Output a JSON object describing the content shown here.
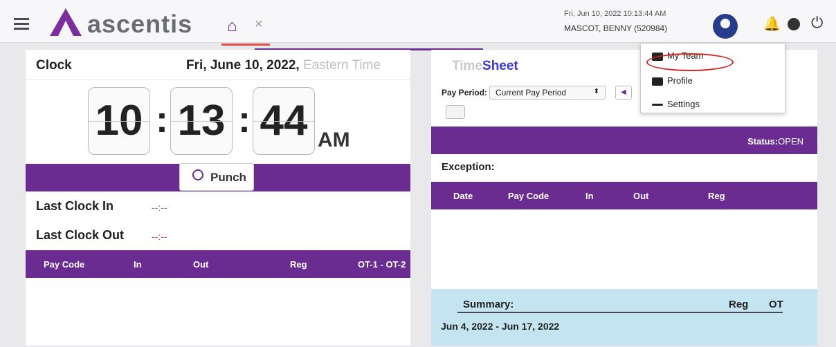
{
  "app": {
    "name": "ascentis"
  },
  "topbar": {
    "date_time": "Fri, Jun 10, 2022 10:13:44 AM",
    "user": "MASCOT, BENNY (520984)"
  },
  "clock": {
    "title": "Clock",
    "date": "Fri, June 10, 2022,",
    "timezone": "Eastern Time",
    "hours": "10",
    "minutes": "13",
    "seconds": "44",
    "ampm": "AM",
    "punch_label": "Punch",
    "last_in_label": "Last Clock In",
    "last_in_value": "--:--",
    "last_out_label": "Last Clock Out",
    "last_out_value": "--:--",
    "columns": [
      "Pay Code",
      "In",
      "Out",
      "Reg",
      "OT-1 - OT-2"
    ]
  },
  "timesheet": {
    "title_prefix": "Time",
    "title_highlight": "Sheet",
    "pay_period_label": "Pay Period:",
    "pay_period_value": "Current Pay Period",
    "status_label": "Status:",
    "status_value": "OPEN",
    "exception_label": "Exception:",
    "columns": [
      "Date",
      "Pay Code",
      "In",
      "Out",
      "Reg"
    ],
    "summary_label": "Summary:",
    "summary_reg": "Reg",
    "summary_ot": "OT",
    "summary_range": "Jun 4, 2022 - Jun 17, 2022"
  },
  "user_menu": {
    "items": [
      "My Team",
      "Profile",
      "Settings"
    ]
  },
  "colors": {
    "brand_purple": "#6a2c91",
    "alert_red": "#d32525",
    "summary_bg": "#c5e4f1"
  }
}
